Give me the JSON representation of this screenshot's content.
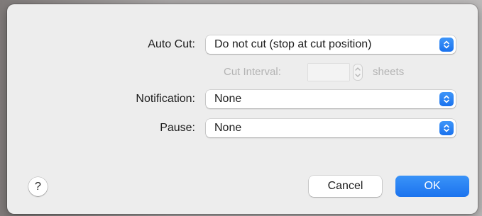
{
  "dialog": {
    "auto_cut": {
      "label": "Auto Cut:",
      "value": "Do not cut (stop at cut position)"
    },
    "cut_interval": {
      "label": "Cut Interval:",
      "value": "",
      "unit": "sheets"
    },
    "notification": {
      "label": "Notification:",
      "value": "None"
    },
    "pause": {
      "label": "Pause:",
      "value": "None"
    },
    "help_label": "?",
    "cancel_label": "Cancel",
    "ok_label": "OK"
  },
  "colors": {
    "accent": "#1b73ee",
    "dialog_bg": "#ededed",
    "disabled_text": "#b3b3b3"
  }
}
